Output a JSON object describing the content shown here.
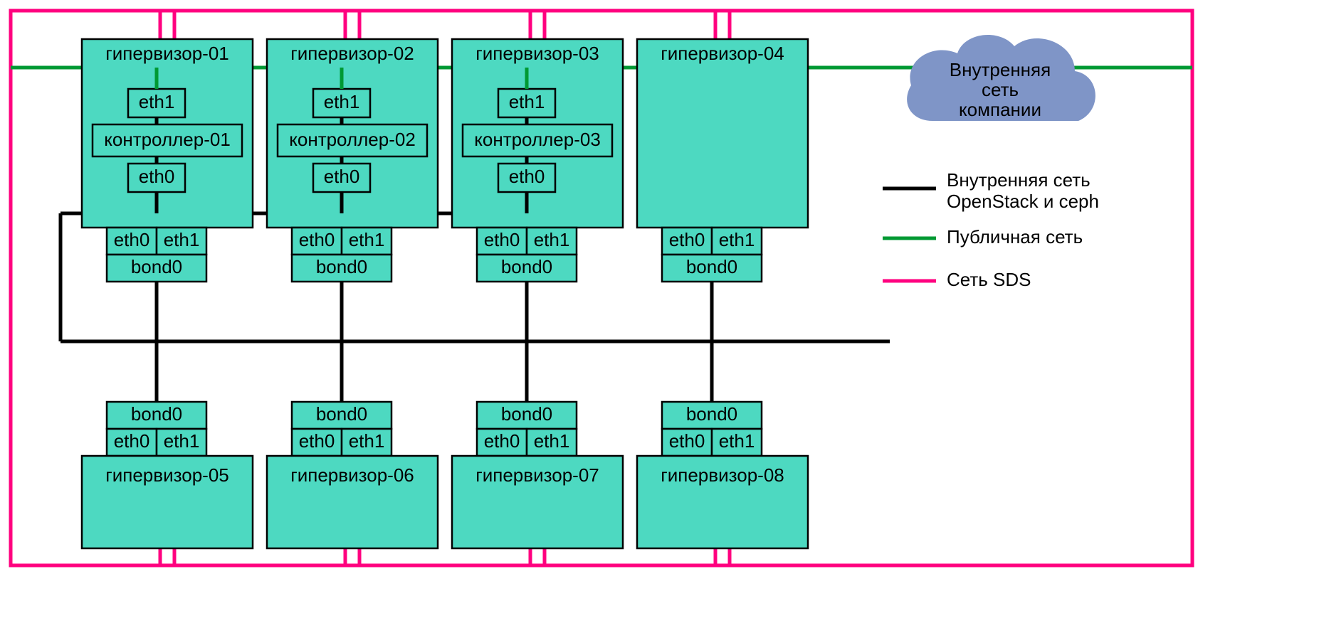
{
  "hypervisors_top": [
    {
      "name": "гипервизор-01",
      "controller": "контроллер-01",
      "eth1": "eth1",
      "eth0": "eth0"
    },
    {
      "name": "гипервизор-02",
      "controller": "контроллер-02",
      "eth1": "eth1",
      "eth0": "eth0"
    },
    {
      "name": "гипервизор-03",
      "controller": "контроллер-03",
      "eth1": "eth1",
      "eth0": "eth0"
    },
    {
      "name": "гипервизор-04"
    }
  ],
  "bonds_top": [
    {
      "eth0": "eth0",
      "eth1": "eth1",
      "bond": "bond0"
    },
    {
      "eth0": "eth0",
      "eth1": "eth1",
      "bond": "bond0"
    },
    {
      "eth0": "eth0",
      "eth1": "eth1",
      "bond": "bond0"
    },
    {
      "eth0": "eth0",
      "eth1": "eth1",
      "bond": "bond0"
    }
  ],
  "bonds_bottom": [
    {
      "bond": "bond0",
      "eth0": "eth0",
      "eth1": "eth1"
    },
    {
      "bond": "bond0",
      "eth0": "eth0",
      "eth1": "eth1"
    },
    {
      "bond": "bond0",
      "eth0": "eth0",
      "eth1": "eth1"
    },
    {
      "bond": "bond0",
      "eth0": "eth0",
      "eth1": "eth1"
    }
  ],
  "hypervisors_bottom": [
    {
      "name": "гипервизор-05"
    },
    {
      "name": "гипервизор-06"
    },
    {
      "name": "гипервизор-07"
    },
    {
      "name": "гипервизор-08"
    }
  ],
  "cloud": {
    "line1": "Внутренняя",
    "line2": "сеть",
    "line3": "компании"
  },
  "legend": {
    "black_l1": "Внутренняя сеть",
    "black_l2": "OpenStack и ceph",
    "green": "Публичная сеть",
    "pink": "Сеть SDS"
  }
}
